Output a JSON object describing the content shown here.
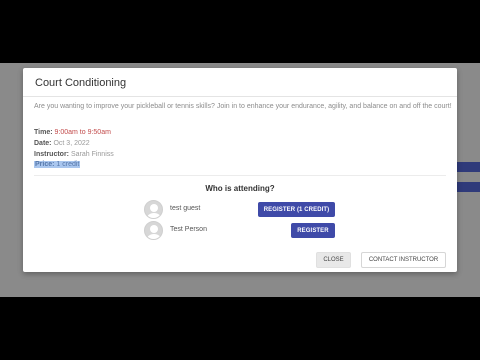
{
  "modal": {
    "title": "Court Conditioning",
    "description": "Are you wanting to improve your pickleball or tennis skills? Join in to enhance your endurance, agility, and balance on and off the court!",
    "time_label": "Time:",
    "time_value": "9:00am to 9:50am",
    "date_label": "Date:",
    "date_value": "Oct 3, 2022",
    "instructor_label": "Instructor:",
    "instructor_value": "Sarah Finniss",
    "price_label": "Price:",
    "price_value": "1 credit",
    "attending_heading": "Who is attending?",
    "attendees": [
      {
        "name": "test guest",
        "button": "REGISTER (1 CREDIT)",
        "avatar_icon": "user-avatar-icon"
      },
      {
        "name": "Test Person",
        "button": "REGISTER",
        "avatar_icon": "user-avatar-icon"
      }
    ],
    "close_label": "CLOSE",
    "contact_label": "CONTACT INSTRUCTOR"
  },
  "colors": {
    "primary_button": "#3f4aa8",
    "time_text": "#c24b4b",
    "overlay": "#8a8a8a",
    "selection_highlight": "#a9c6ee"
  }
}
